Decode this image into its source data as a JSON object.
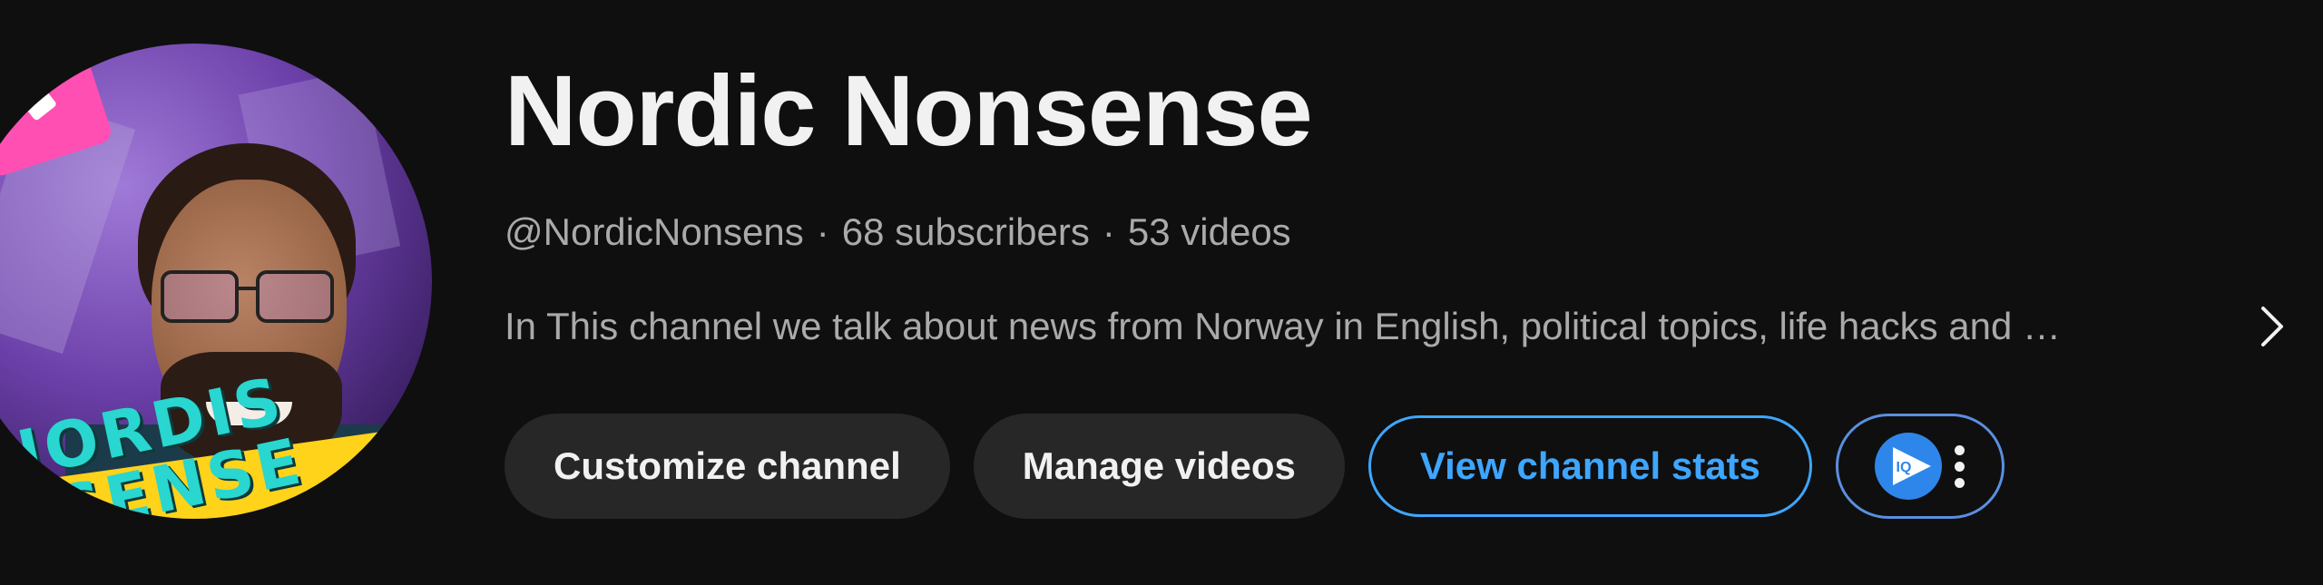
{
  "channel": {
    "name": "Nordic Nonsense",
    "handle": "@NordicNonsens",
    "separator": "·",
    "subscribers": "68 subscribers",
    "videos": "53 videos",
    "description": "In This channel we talk about news from Norway in English, political topics, life hacks and …",
    "avatar": {
      "logo_line_1": "NORDIS",
      "logo_line_2": "NSENSE"
    }
  },
  "actions": {
    "customize": "Customize channel",
    "manage": "Manage videos",
    "stats": "View channel stats",
    "extension_icon": "vidiq-icon",
    "extension_icon_text": "IQ",
    "more_icon": "more-vertical-icon"
  },
  "colors": {
    "background": "#0f0f0f",
    "text_primary": "#f1f1f1",
    "text_secondary": "#aaaaaa",
    "button_gray": "#272727",
    "accent_blue": "#3ea6ff",
    "extension_blue": "#2e86ea"
  }
}
